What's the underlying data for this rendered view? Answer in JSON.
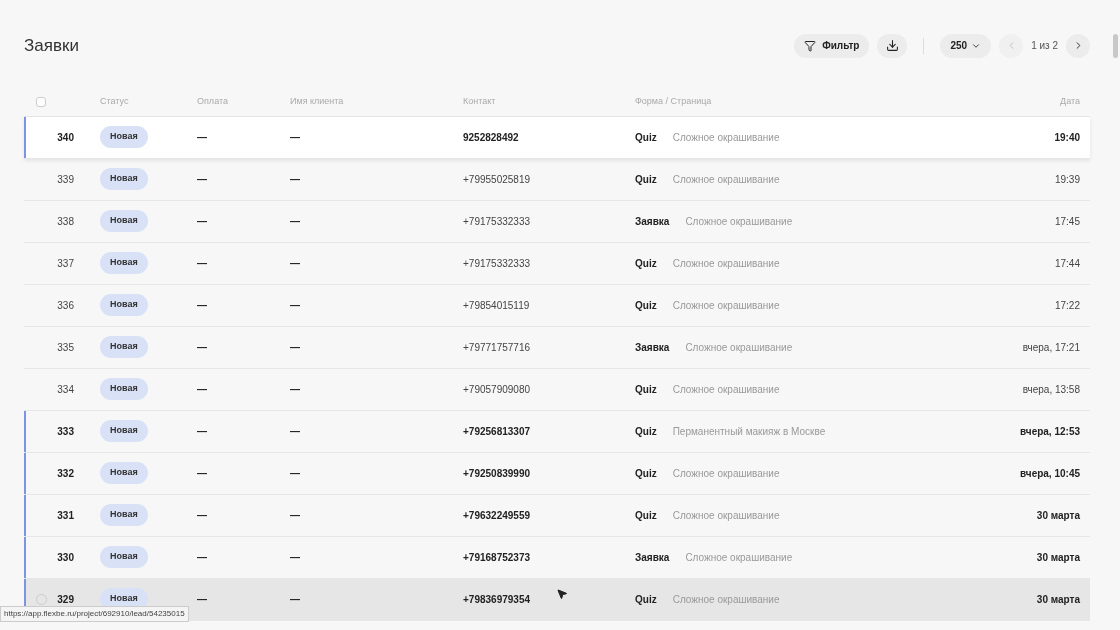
{
  "page": {
    "title": "Заявки"
  },
  "toolbar": {
    "filter_label": "Фильтр",
    "per_page": "250",
    "pagination": "1 из 2"
  },
  "table": {
    "select_all": {
      "checked": false
    },
    "columns": [
      "Статус",
      "Оплата",
      "Имя клиента",
      "Контакт",
      "Форма / Страница",
      "Дата"
    ],
    "rows": [
      {
        "id": "340",
        "status": "Новая",
        "payment": "—",
        "client": "—",
        "contact": "9252828492",
        "form": "Quiz",
        "page": "Сложное окрашивание",
        "date": "19:40",
        "unread": true,
        "hovered": false
      },
      {
        "id": "339",
        "status": "Новая",
        "payment": "—",
        "client": "—",
        "contact": "+79955025819",
        "form": "Quiz",
        "page": "Сложное окрашивание",
        "date": "19:39",
        "unread": false,
        "hovered": false
      },
      {
        "id": "338",
        "status": "Новая",
        "payment": "—",
        "client": "—",
        "contact": "+79175332333",
        "form": "Заявка",
        "page": "Сложное окрашивание",
        "date": "17:45",
        "unread": false,
        "hovered": false
      },
      {
        "id": "337",
        "status": "Новая",
        "payment": "—",
        "client": "—",
        "contact": "+79175332333",
        "form": "Quiz",
        "page": "Сложное окрашивание",
        "date": "17:44",
        "unread": false,
        "hovered": false
      },
      {
        "id": "336",
        "status": "Новая",
        "payment": "—",
        "client": "—",
        "contact": "+79854015119",
        "form": "Quiz",
        "page": "Сложное окрашивание",
        "date": "17:22",
        "unread": false,
        "hovered": false
      },
      {
        "id": "335",
        "status": "Новая",
        "payment": "—",
        "client": "—",
        "contact": "+79771757716",
        "form": "Заявка",
        "page": "Сложное окрашивание",
        "date": "вчера, 17:21",
        "unread": false,
        "hovered": false
      },
      {
        "id": "334",
        "status": "Новая",
        "payment": "—",
        "client": "—",
        "contact": "+79057909080",
        "form": "Quiz",
        "page": "Сложное окрашивание",
        "date": "вчера, 13:58",
        "unread": false,
        "hovered": false
      },
      {
        "id": "333",
        "status": "Новая",
        "payment": "—",
        "client": "—",
        "contact": "+79256813307",
        "form": "Quiz",
        "page": "Перманентный макияж в Москве",
        "date": "вчера, 12:53",
        "unread": true,
        "hovered": false
      },
      {
        "id": "332",
        "status": "Новая",
        "payment": "—",
        "client": "—",
        "contact": "+79250839990",
        "form": "Quiz",
        "page": "Сложное окрашивание",
        "date": "вчера, 10:45",
        "unread": true,
        "hovered": false
      },
      {
        "id": "331",
        "status": "Новая",
        "payment": "—",
        "client": "—",
        "contact": "+79632249559",
        "form": "Quiz",
        "page": "Сложное окрашивание",
        "date": "30 марта",
        "unread": true,
        "hovered": false
      },
      {
        "id": "330",
        "status": "Новая",
        "payment": "—",
        "client": "—",
        "contact": "+79168752373",
        "form": "Заявка",
        "page": "Сложное окрашивание",
        "date": "30 марта",
        "unread": true,
        "hovered": false
      },
      {
        "id": "329",
        "status": "Новая",
        "payment": "—",
        "client": "—",
        "contact": "+79836979354",
        "form": "Quiz",
        "page": "Сложное окрашивание",
        "date": "30 марта",
        "unread": true,
        "hovered": true
      }
    ]
  },
  "status_bar": {
    "url": "https://app.flexbe.ru/project/692910/lead/54235015"
  }
}
